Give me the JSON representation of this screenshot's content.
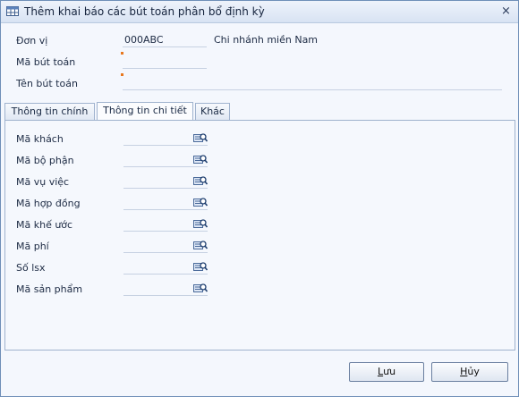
{
  "window": {
    "title": "Thêm khai báo các bút toán phân bổ định kỳ",
    "close_glyph": "×"
  },
  "header_fields": {
    "don_vi": {
      "label": "Đơn vị",
      "code": "000ABC",
      "name": "Chi nhánh miền Nam"
    },
    "ma_but_toan": {
      "label": "Mã bút toán",
      "value": ""
    },
    "ten_but_toan": {
      "label": "Tên bút toán",
      "value": ""
    }
  },
  "tabs": [
    {
      "label": "Thông tin chính",
      "active": false
    },
    {
      "label": "Thông tin chi tiết",
      "active": true
    },
    {
      "label": "Khác",
      "active": false
    }
  ],
  "detail_fields": [
    {
      "label": "Mã khách",
      "value": "",
      "icon": "lookup-icon"
    },
    {
      "label": "Mã bộ phận",
      "value": "",
      "icon": "lookup-icon"
    },
    {
      "label": "Mã vụ việc",
      "value": "",
      "icon": "lookup-icon"
    },
    {
      "label": "Mã hợp đồng",
      "value": "",
      "icon": "lookup-icon"
    },
    {
      "label": "Mã khế ước",
      "value": "",
      "icon": "lookup-icon"
    },
    {
      "label": "Mã phí",
      "value": "",
      "icon": "lookup-icon"
    },
    {
      "label": "Số lsx",
      "value": "",
      "icon": "lookup-icon"
    },
    {
      "label": "Mã sản phẩm",
      "value": "",
      "icon": "lookup-icon"
    }
  ],
  "buttons": {
    "save": {
      "mnemonic": "L",
      "rest": "ưu"
    },
    "cancel": {
      "mnemonic": "H",
      "rest": "ủy"
    }
  },
  "colors": {
    "required_marker": "#e8781e",
    "border": "#9fb2ce",
    "accent": "#6f8fb8"
  }
}
